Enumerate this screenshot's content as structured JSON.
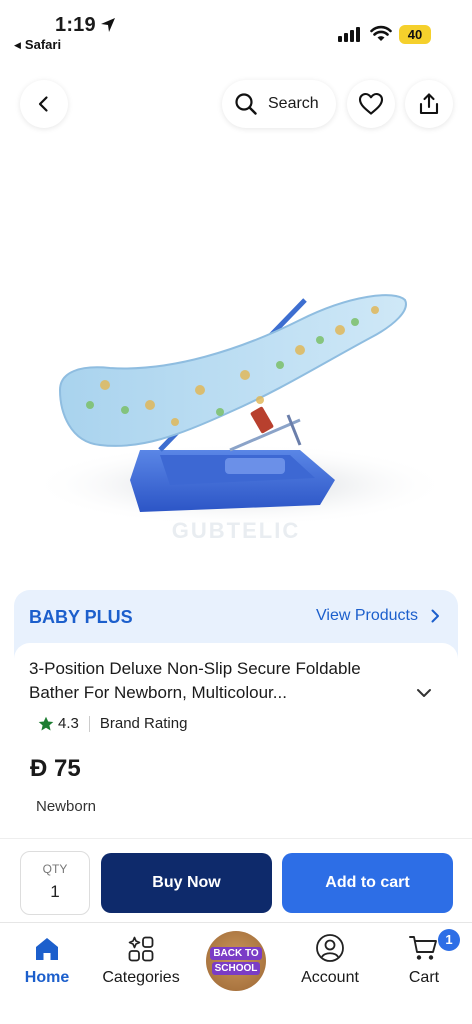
{
  "status_bar": {
    "time": "1:19",
    "back_app": "Safari",
    "battery": "40",
    "battery_color": "#f5d02c"
  },
  "top_nav": {
    "back_icon": "chevron-left-icon",
    "search_label": "Search",
    "favorite_icon": "heart-icon",
    "share_icon": "share-icon"
  },
  "product_image": {
    "watermark": "GUBTELIC"
  },
  "brand": {
    "name": "BABY PLUS",
    "view_products_label": "View Products"
  },
  "product": {
    "title": "3-Position Deluxe Non-Slip Secure Foldable Bather For Newborn, Multicolour...",
    "rating": "4.3",
    "rating_label": "Brand Rating",
    "price": "75",
    "currency_symbol": "Đ",
    "tag": "Newborn"
  },
  "action_bar": {
    "qty_label": "QTY",
    "qty_value": "1",
    "buy_now_label": "Buy Now",
    "add_to_cart_label": "Add to cart"
  },
  "tab_bar": {
    "home_label": "Home",
    "categories_label": "Categories",
    "promo_line1": "BACK TO",
    "promo_line2": "SCHOOL",
    "account_label": "Account",
    "cart_label": "Cart",
    "cart_count": "1"
  },
  "colors": {
    "brand_blue": "#1c5fcc",
    "buy_now_bg": "#0e2a6b",
    "add_cart_bg": "#2d6ee6",
    "brand_card_bg": "#e8f1fd",
    "rating_star": "#1e7d32"
  }
}
